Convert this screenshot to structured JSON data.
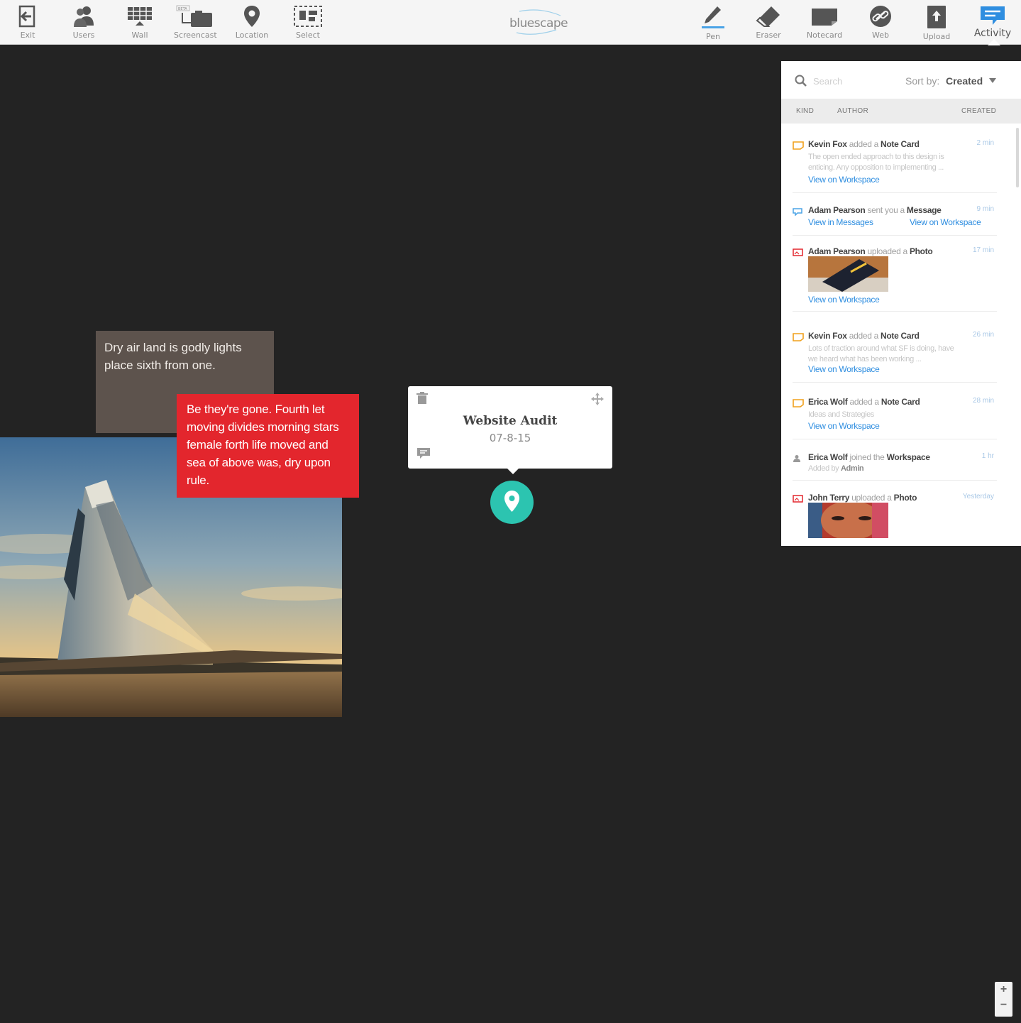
{
  "toolbar": {
    "left_tools": [
      {
        "label": "Exit",
        "icon": "exit-icon"
      },
      {
        "label": "Users",
        "icon": "users-icon"
      },
      {
        "label": "Wall",
        "icon": "wall-icon"
      },
      {
        "label": "Screencast",
        "icon": "screencast-icon",
        "badge": "BETA"
      },
      {
        "label": "Location",
        "icon": "location-pin-icon"
      },
      {
        "label": "Select",
        "icon": "select-icon"
      }
    ],
    "logo": "bluescape",
    "right_tools": [
      {
        "label": "Pen",
        "icon": "pen-icon"
      },
      {
        "label": "Eraser",
        "icon": "eraser-icon"
      },
      {
        "label": "Notecard",
        "icon": "notecard-icon"
      },
      {
        "label": "Web",
        "icon": "link-icon"
      },
      {
        "label": "Upload",
        "icon": "upload-icon"
      },
      {
        "label": "Activity",
        "icon": "activity-icon",
        "active": true
      }
    ]
  },
  "canvas": {
    "note_brown": "Dry air land is godly lights place sixth from one.",
    "note_red": "Be they're gone. Fourth let moving divides morning stars female forth life moved and sea of above was, dry upon rule.",
    "location_card": {
      "title": "Website Audit",
      "date": "07-8-15"
    }
  },
  "activity": {
    "search_placeholder": "Search",
    "sort_label": "Sort by:",
    "sort_value": "Created",
    "columns": {
      "kind": "KIND",
      "author": "AUTHOR",
      "created": "CREATED"
    },
    "items": [
      {
        "kind": "notecard",
        "author": "Kevin Fox",
        "action": "added a",
        "object": "Note Card",
        "time": "2 min",
        "desc": "The open ended approach to this design is enticing. Any opposition to implementing ...",
        "link": "View on Workspace"
      },
      {
        "kind": "message",
        "author": "Adam Pearson",
        "action": "sent you a",
        "object": "Message",
        "time": "9 min",
        "link": "View in Messages",
        "link2": "View on Workspace"
      },
      {
        "kind": "photo",
        "author": "Adam Pearson",
        "action": "uploaded a",
        "object": "Photo",
        "time": "17 min",
        "link": "View on Workspace"
      },
      {
        "kind": "notecard",
        "author": "Kevin Fox",
        "action": "added a",
        "object": "Note Card",
        "time": "26 min",
        "desc": "Lots of traction around what SF is doing, have we heard what has been working ...",
        "link": "View on Workspace"
      },
      {
        "kind": "notecard",
        "author": "Erica Wolf",
        "action": "added a",
        "object": "Note Card",
        "time": "28 min",
        "desc": "Ideas and Strategies",
        "link": "View on Workspace"
      },
      {
        "kind": "user",
        "author": "Erica Wolf",
        "action": "joined the",
        "object": "Workspace",
        "time": "1 hr",
        "desc_prefix": "Added by",
        "desc_author": "Admin"
      },
      {
        "kind": "photo",
        "author": "John Terry",
        "action": "uploaded a",
        "object": "Photo",
        "time": "Yesterday"
      }
    ]
  },
  "zoom": {
    "in": "+",
    "out": "−"
  },
  "colors": {
    "accent": "#2f8ee0",
    "pin": "#2cc4b0",
    "note_red": "#e3262d",
    "note_brown": "#5d534d",
    "canvas": "#232323"
  }
}
